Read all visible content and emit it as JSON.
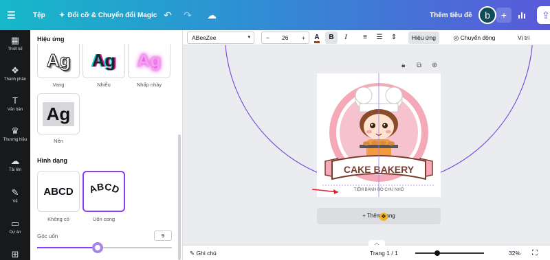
{
  "topbar": {
    "file_label": "Tệp",
    "magic_label": "Đổi cỡ & Chuyển đổi Magic",
    "title_placeholder": "Thêm tiêu đề",
    "avatar_letter": "b",
    "plus": "+"
  },
  "rail": [
    {
      "label": "Thiết kế",
      "icon": "layout-icon"
    },
    {
      "label": "Thành phần",
      "icon": "elements-icon"
    },
    {
      "label": "Văn bản",
      "icon": "text-icon"
    },
    {
      "label": "Thương hiệu",
      "icon": "brand-icon"
    },
    {
      "label": "Tải lên",
      "icon": "upload-icon"
    },
    {
      "label": "Vẽ",
      "icon": "draw-icon"
    },
    {
      "label": "Dự án",
      "icon": "folder-icon"
    },
    {
      "label": "Ứng dụng",
      "icon": "apps-icon"
    }
  ],
  "panel": {
    "title": "Hiệu ứng",
    "effects": [
      {
        "label": "Vang",
        "sample": "Ag"
      },
      {
        "label": "Nhiễu",
        "sample": "Ag"
      },
      {
        "label": "Nhấp nháy",
        "sample": "Ag"
      },
      {
        "label": "Nền",
        "sample": "Ag"
      }
    ],
    "shape_title": "Hình dạng",
    "shapes": [
      {
        "label": "Không có",
        "sample": "ABCD"
      },
      {
        "label": "Uốn cong",
        "sample": "ABCD"
      }
    ],
    "slider_label": "Góc uốn",
    "slider_value": "9",
    "slider_level": 0.45
  },
  "toolbar": {
    "font": "ABeeZee",
    "minus": "−",
    "size": "26",
    "plus": "+",
    "text_color_glyph": "A",
    "bold": "B",
    "italic": "I",
    "effects": "Hiệu ứng",
    "animate": "Chuyển động",
    "position": "Vị trí"
  },
  "design": {
    "brand": "CAKE BAKERY",
    "tagline": "TIỆM BÁNH BÔ CHÚ NHỎ"
  },
  "canvas": {
    "add_page": "+ Thêm trang"
  },
  "bottom": {
    "notes": "Ghi chú",
    "page": "Trang 1 / 1",
    "zoom": "32%",
    "zoom_level": 0.32
  },
  "colors": {
    "accent": "#8b3dff",
    "topbar_start": "#16b8c9",
    "topbar_end": "#5a59d9",
    "banner": "#f4a8b8",
    "banner_dark": "#7a3a2e",
    "arrow": "#e0202a"
  }
}
